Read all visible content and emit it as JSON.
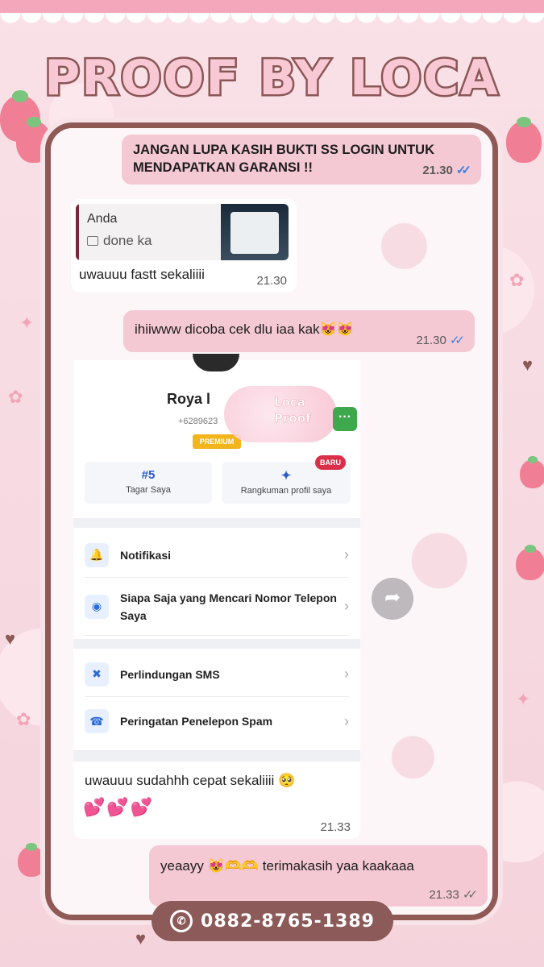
{
  "header": {
    "title": "PROOF BY LOCA"
  },
  "chat": {
    "msg1": {
      "text": "JANGAN LUPA KASIH BUKTI SS LOGIN UNTUK MENDAPATKAN GARANSI !!",
      "time": "21.30",
      "status_icon": "double-check-blue"
    },
    "msg2": {
      "quoted_author": "Anda",
      "quoted_text": "done ka",
      "text": "uwauuu fastt sekaliiii",
      "time": "21.30"
    },
    "msg3": {
      "text": "ihiiwww dicoba cek dlu iaa kak😻😻",
      "time": "21.30",
      "status_icon": "double-check-blue"
    },
    "screenshot": {
      "name": "Roya l",
      "number": "+6289623",
      "badge": "PREMIUM",
      "watermark": "Loca\nProof",
      "cards": [
        {
          "big": "#5",
          "label": "Tagar Saya"
        },
        {
          "big": "✦",
          "label": "Rangkuman profil saya",
          "badge": "BARU"
        }
      ],
      "menu": [
        {
          "label": "Notifikasi",
          "icon": "bell-icon"
        },
        {
          "label": "Siapa Saja yang Mencari Nomor Telepon Saya",
          "icon": "eye-icon"
        },
        {
          "label": "Perlindungan SMS",
          "icon": "shield-icon"
        },
        {
          "label": "Peringatan Penelepon Spam",
          "icon": "phone-block-icon"
        }
      ]
    },
    "msg4": {
      "text": "uwauuu sudahhh cepat sekaliiii 🥺",
      "hearts": "💕💕💕",
      "time": "21.33"
    },
    "msg5": {
      "text": "yeaayy 😻🫶🫶 terimakasih yaa kaakaaa",
      "time": "21.33",
      "status_icon": "double-check-grey"
    }
  },
  "footer": {
    "phone": "0882-8765-1389",
    "icon": "whatsapp-icon"
  }
}
